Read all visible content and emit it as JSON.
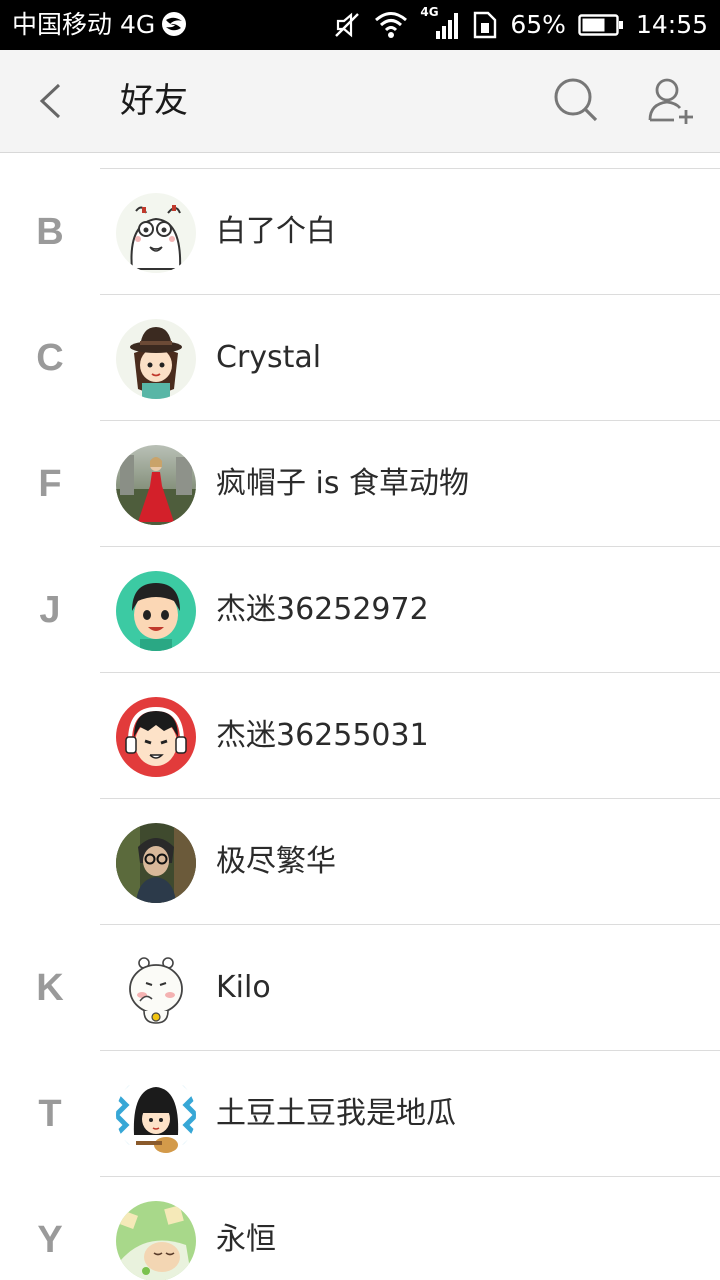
{
  "status_bar": {
    "carrier": "中国移动 4G",
    "network": "4G",
    "battery": "65%",
    "time": "14:55",
    "icons": [
      "carrier-logo-icon",
      "mute-icon",
      "wifi-icon",
      "signal-icon",
      "sim-icon",
      "battery-icon"
    ]
  },
  "header": {
    "title": "好友",
    "icons": [
      "back-chevron-icon",
      "search-icon",
      "add-friend-icon"
    ]
  },
  "contacts": [
    {
      "letter": "B",
      "name": "白了个白",
      "avatar": "cartoon-face-avatar"
    },
    {
      "letter": "C",
      "name": "Crystal",
      "avatar": "girl-hat-avatar"
    },
    {
      "letter": "F",
      "name": "疯帽子 is 食草动物",
      "avatar": "red-dress-photo-avatar"
    },
    {
      "letter": "J",
      "name": "杰迷36252972",
      "avatar": "cartoon-boy-avatar"
    },
    {
      "letter": "",
      "name": "杰迷36255031",
      "avatar": "headphones-boy-avatar"
    },
    {
      "letter": "",
      "name": "极尽繁华",
      "avatar": "glasses-photo-avatar"
    },
    {
      "letter": "K",
      "name": "Kilo",
      "avatar": "bear-avatar"
    },
    {
      "letter": "T",
      "name": "土豆土豆我是地瓜",
      "avatar": "girl-guitar-avatar"
    },
    {
      "letter": "Y",
      "name": "永恒",
      "avatar": "sleeping-baby-avatar"
    }
  ],
  "colors": {
    "status_bar": "#000000",
    "header_bg": "#f4f4f4",
    "letter": "#9a9a9a",
    "divider": "#dcdcdc"
  }
}
